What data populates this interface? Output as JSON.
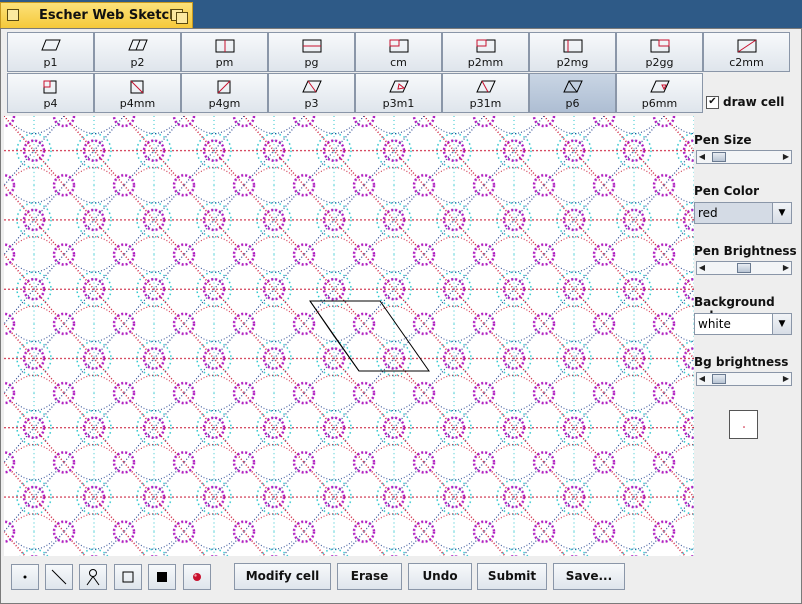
{
  "window": {
    "title": "Escher Web Sketch"
  },
  "groups": [
    {
      "label": "p1",
      "glyph": "p1-icon"
    },
    {
      "label": "p2",
      "glyph": "p2-icon"
    },
    {
      "label": "pm",
      "glyph": "pm-icon"
    },
    {
      "label": "pg",
      "glyph": "pg-icon"
    },
    {
      "label": "cm",
      "glyph": "cm-icon"
    },
    {
      "label": "p2mm",
      "glyph": "p2mm-icon"
    },
    {
      "label": "p2mg",
      "glyph": "p2mg-icon"
    },
    {
      "label": "p2gg",
      "glyph": "p2gg-icon"
    },
    {
      "label": "c2mm",
      "glyph": "c2mm-icon"
    },
    {
      "label": "p4",
      "glyph": "p4-icon"
    },
    {
      "label": "p4mm",
      "glyph": "p4mm-icon"
    },
    {
      "label": "p4gm",
      "glyph": "p4gm-icon"
    },
    {
      "label": "p3",
      "glyph": "p3-icon"
    },
    {
      "label": "p3m1",
      "glyph": "p3m1-icon"
    },
    {
      "label": "p31m",
      "glyph": "p31m-icon"
    },
    {
      "label": "p6",
      "glyph": "p6-icon"
    },
    {
      "label": "p6mm",
      "glyph": "p6mm-icon"
    }
  ],
  "selected_group": "p6",
  "draw_cell": {
    "label": "draw cell",
    "checked": true,
    "mark": "✔"
  },
  "pen_size": {
    "label": "Pen Size",
    "level": 0.08
  },
  "pen_color": {
    "label": "Pen Color",
    "value": "red"
  },
  "pen_brightness": {
    "label": "Pen Brightness",
    "level": 0.5
  },
  "background_color": {
    "label": "Background color",
    "value": "white"
  },
  "bg_brightness": {
    "label": "Bg brightness",
    "level": 0.08
  },
  "tools": [
    "dot-tool-icon",
    "line-tool-icon",
    "stamp-tool-icon",
    "outline-rect-tool-icon",
    "filled-rect-tool-icon",
    "red-ball-tool-icon"
  ],
  "actions": {
    "modify_cell": "Modify cell",
    "erase": "Erase",
    "undo": "Undo",
    "submit": "Submit",
    "save": "Save..."
  },
  "colors": {
    "accent": "#2e5a87",
    "pen": "#c8102e",
    "cyan": "#27c4cc",
    "magenta": "#b020c0",
    "title_tab": "#f5c93a"
  }
}
